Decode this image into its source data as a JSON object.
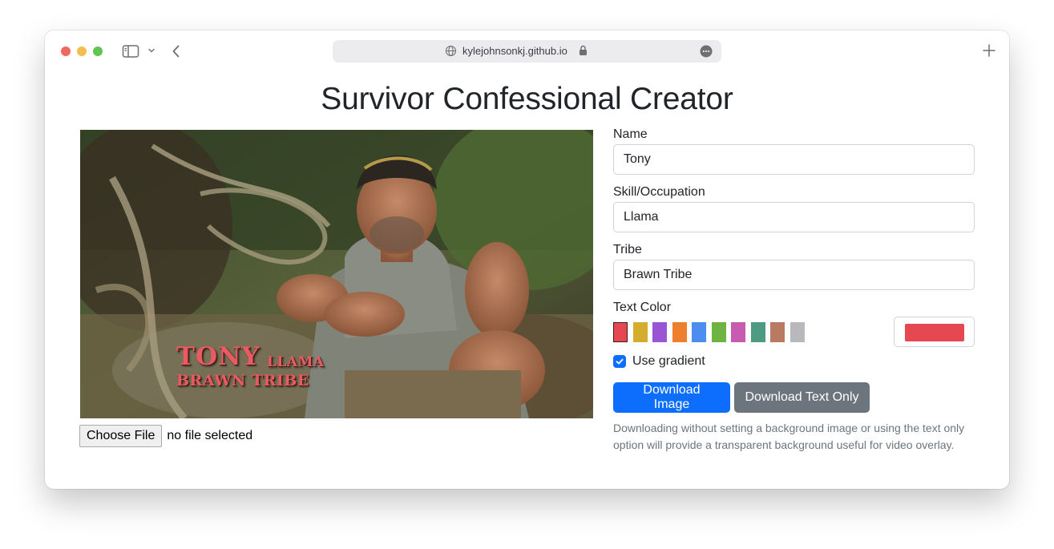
{
  "browser": {
    "url": "kylejohnsonkj.github.io"
  },
  "page": {
    "title": "Survivor Confessional Creator"
  },
  "preview": {
    "name_text": "TONY",
    "skill_text": "LLAMA",
    "tribe_text": "BRAWN TRIBE"
  },
  "file_picker": {
    "button_label": "Choose File",
    "status": "no file selected"
  },
  "form": {
    "name_label": "Name",
    "name_value": "Tony",
    "skill_label": "Skill/Occupation",
    "skill_value": "Llama",
    "tribe_label": "Tribe",
    "tribe_value": "Brawn Tribe",
    "text_color_label": "Text Color",
    "swatches": [
      "#e64851",
      "#d4ad2f",
      "#9a55d5",
      "#ee7f2d",
      "#4b8ef0",
      "#6db443",
      "#c75bb2",
      "#4d9b83",
      "#b97a62",
      "#b8b8bd"
    ],
    "selected_color": "#e64851",
    "gradient_label": "Use gradient",
    "gradient_checked": true,
    "download_image_label": "Download Image",
    "download_text_label": "Download Text Only",
    "help_text": "Downloading without setting a background image or using the text only option will provide a transparent background useful for video overlay."
  },
  "colors": {
    "primary": "#0d6efd",
    "secondary": "#6c757d",
    "overlay_text": "#ea5a60"
  }
}
